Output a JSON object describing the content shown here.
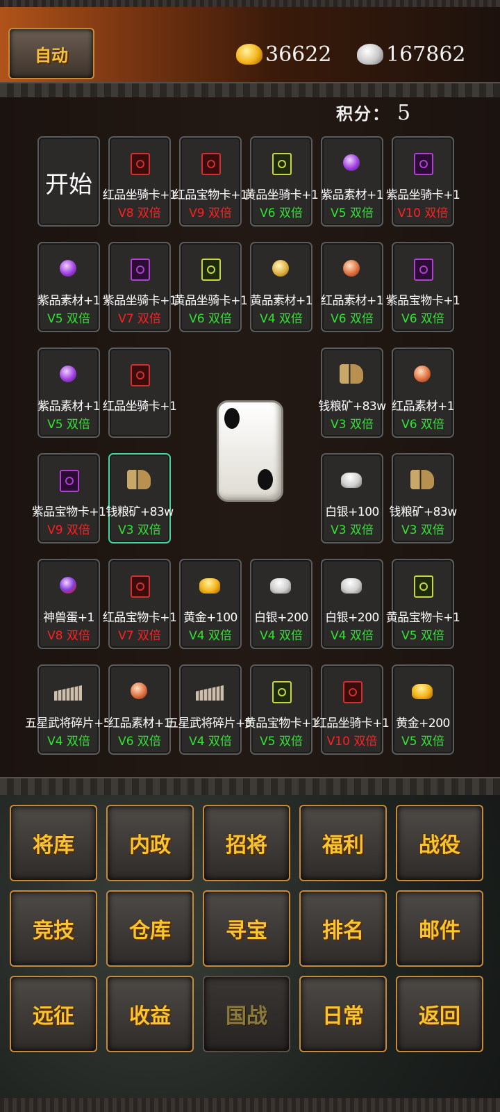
{
  "header": {
    "auto_label": "自动",
    "gold_amount": "36622",
    "silver_amount": "167862",
    "gold_icon": "gold-ingot-icon",
    "silver_icon": "silver-ingot-icon"
  },
  "score": {
    "label": "积分：",
    "value": "5"
  },
  "board": {
    "start_label": "开始",
    "cells": [
      {
        "icon": "card-red",
        "label": "红品坐骑卡+1",
        "level": "V8 双倍",
        "level_color": "red"
      },
      {
        "icon": "card-red",
        "label": "红品宝物卡+1",
        "level": "V9 双倍",
        "level_color": "red"
      },
      {
        "icon": "card-yellow",
        "label": "黄品坐骑卡+1",
        "level": "V6 双倍",
        "level_color": "green"
      },
      {
        "icon": "gem-purple",
        "label": "紫品素材+1",
        "level": "V5 双倍",
        "level_color": "green"
      },
      {
        "icon": "card-purple",
        "label": "紫品坐骑卡+1",
        "level": "V10 双倍",
        "level_color": "red"
      },
      {
        "icon": "gem-purple",
        "label": "紫品素材+1",
        "level": "V5 双倍",
        "level_color": "green"
      },
      {
        "icon": "card-purple",
        "label": "紫品坐骑卡+1",
        "level": "V7 双倍",
        "level_color": "red"
      },
      {
        "icon": "card-yellow",
        "label": "黄品坐骑卡+1",
        "level": "V6 双倍",
        "level_color": "green"
      },
      {
        "icon": "gem-yellow",
        "label": "黄品素材+1",
        "level": "V4 双倍",
        "level_color": "green"
      },
      {
        "icon": "gem-red",
        "label": "红品素材+1",
        "level": "V6 双倍",
        "level_color": "green"
      },
      {
        "icon": "card-purple",
        "label": "紫品宝物卡+1",
        "level": "V6 双倍",
        "level_color": "green"
      },
      {
        "icon": "gem-purple",
        "label": "紫品素材+1",
        "level": "V5 双倍",
        "level_color": "green"
      },
      {
        "icon": "card-red",
        "label": "红品坐骑卡+1",
        "level": "",
        "level_color": "green"
      },
      {
        "icon": "grain",
        "label": "钱粮矿+83w",
        "level": "V3 双倍",
        "level_color": "green"
      },
      {
        "icon": "gem-red",
        "label": "红品素材+1",
        "level": "V6 双倍",
        "level_color": "green"
      },
      {
        "icon": "card-purple",
        "label": "紫品宝物卡+1",
        "level": "V9 双倍",
        "level_color": "red"
      },
      {
        "icon": "grain",
        "label": "钱粮矿+83w",
        "level": "V3 双倍",
        "level_color": "green"
      },
      {
        "icon": "ingot-silver",
        "label": "白银+100",
        "level": "V3 双倍",
        "level_color": "green"
      },
      {
        "icon": "grain",
        "label": "钱粮矿+83w",
        "level": "V3 双倍",
        "level_color": "green"
      },
      {
        "icon": "gem-egg",
        "label": "神兽蛋+1",
        "level": "V8 双倍",
        "level_color": "red"
      },
      {
        "icon": "card-red",
        "label": "红品宝物卡+1",
        "level": "V7 双倍",
        "level_color": "red"
      },
      {
        "icon": "ingot-gold",
        "label": "黄金+100",
        "level": "V4 双倍",
        "level_color": "green"
      },
      {
        "icon": "ingot-silver",
        "label": "白银+200",
        "level": "V4 双倍",
        "level_color": "green"
      },
      {
        "icon": "ingot-silver",
        "label": "白银+200",
        "level": "V4 双倍",
        "level_color": "green"
      },
      {
        "icon": "card-yellow",
        "label": "黄品宝物卡+1",
        "level": "V5 双倍",
        "level_color": "green"
      },
      {
        "icon": "shard",
        "label": "五星武将碎片+50",
        "level": "V4 双倍",
        "level_color": "green"
      },
      {
        "icon": "gem-red",
        "label": "红品素材+1",
        "level": "V6 双倍",
        "level_color": "green"
      },
      {
        "icon": "shard",
        "label": "五星武将碎片+50",
        "level": "V4 双倍",
        "level_color": "green"
      },
      {
        "icon": "card-yellow",
        "label": "黄品宝物卡+1",
        "level": "V5 双倍",
        "level_color": "green"
      },
      {
        "icon": "card-red",
        "label": "红品坐骑卡+1",
        "level": "V10 双倍",
        "level_color": "red"
      },
      {
        "icon": "ingot-gold",
        "label": "黄金+200",
        "level": "V5 双倍",
        "level_color": "green"
      }
    ],
    "dice_value": 2
  },
  "menu": {
    "buttons": [
      {
        "label": "将库",
        "enabled": true
      },
      {
        "label": "内政",
        "enabled": true
      },
      {
        "label": "招将",
        "enabled": true
      },
      {
        "label": "福利",
        "enabled": true
      },
      {
        "label": "战役",
        "enabled": true
      },
      {
        "label": "竞技",
        "enabled": true
      },
      {
        "label": "仓库",
        "enabled": true
      },
      {
        "label": "寻宝",
        "enabled": true
      },
      {
        "label": "排名",
        "enabled": true
      },
      {
        "label": "邮件",
        "enabled": true
      },
      {
        "label": "远征",
        "enabled": true
      },
      {
        "label": "收益",
        "enabled": true
      },
      {
        "label": "国战",
        "enabled": false
      },
      {
        "label": "日常",
        "enabled": true
      },
      {
        "label": "返回",
        "enabled": true
      }
    ]
  },
  "colors": {
    "accent_gold": "#f6c630",
    "selected_border": "#3fd9a0",
    "level_red": "#ff2020",
    "level_green": "#34e234"
  }
}
